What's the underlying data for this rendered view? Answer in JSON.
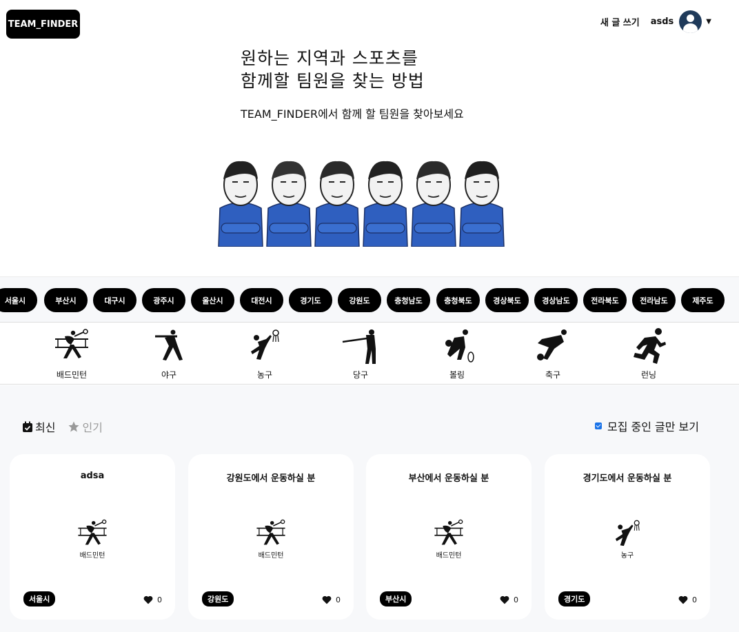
{
  "header": {
    "logo": "TEAM_FINDER",
    "write_label": "새 글 쓰기",
    "username": "asds"
  },
  "hero": {
    "line1": "원하는 지역과 스포츠를",
    "line2": "함께할 팀원을 찾는 방법",
    "subtitle": "TEAM_FINDER에서 함께 할 팀원을 찾아보세요"
  },
  "regions": [
    "서울시",
    "부산시",
    "대구시",
    "광주시",
    "울산시",
    "대전시",
    "경기도",
    "강원도",
    "충청남도",
    "충청북도",
    "경상북도",
    "경상남도",
    "전라북도",
    "전라남도",
    "제주도"
  ],
  "sports": [
    {
      "label": "배드민턴",
      "icon": "badminton-icon"
    },
    {
      "label": "야구",
      "icon": "baseball-icon"
    },
    {
      "label": "농구",
      "icon": "basketball-icon"
    },
    {
      "label": "당구",
      "icon": "billiards-icon"
    },
    {
      "label": "볼링",
      "icon": "bowling-icon"
    },
    {
      "label": "축구",
      "icon": "soccer-icon"
    },
    {
      "label": "런닝",
      "icon": "running-icon"
    }
  ],
  "sort": {
    "latest": "최신",
    "popular": "인기"
  },
  "filter": {
    "label": "모집 중인 글만 보기",
    "checked": true
  },
  "cards": [
    {
      "title": "adsa",
      "sport": "배드민턴",
      "icon": "badminton-icon",
      "region": "서울시",
      "likes": "0"
    },
    {
      "title": "강원도에서 운동하실 분",
      "sport": "배드민턴",
      "icon": "badminton-icon",
      "region": "강원도",
      "likes": "0"
    },
    {
      "title": "부산에서 운동하실 분",
      "sport": "배드민턴",
      "icon": "badminton-icon",
      "region": "부산시",
      "likes": "0"
    },
    {
      "title": "경기도에서 운동하실 분",
      "sport": "농구",
      "icon": "basketball-icon",
      "region": "경기도",
      "likes": "0"
    }
  ]
}
